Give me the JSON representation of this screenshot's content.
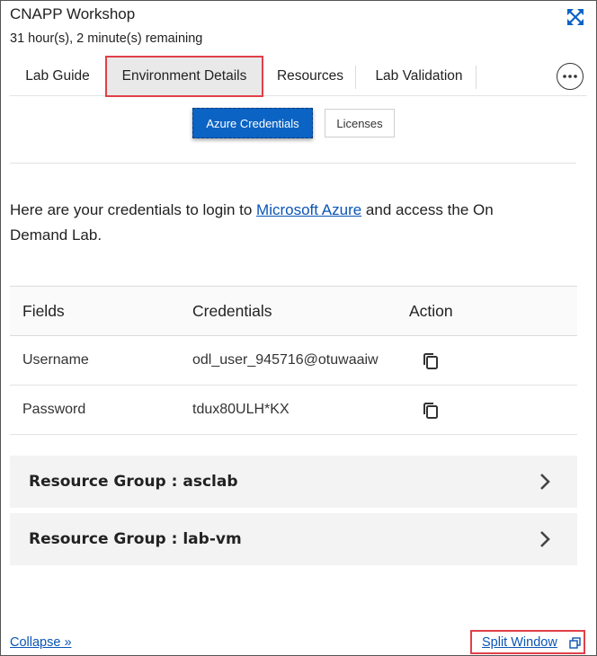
{
  "header": {
    "title": "CNAPP Workshop",
    "timer": "31 hour(s), 2 minute(s) remaining",
    "expand_icon": "expand-arrows-icon"
  },
  "tabs": [
    {
      "label": "Lab Guide",
      "active": false
    },
    {
      "label": "Environment Details",
      "active": true
    },
    {
      "label": "Resources",
      "active": false
    },
    {
      "label": "Lab Validation",
      "active": false
    }
  ],
  "more_icon": "ellipsis-icon",
  "subtabs": {
    "primary": "Azure Credentials",
    "secondary": "Licenses"
  },
  "intro": {
    "before": "Here are your credentials to login to ",
    "link": "Microsoft Azure",
    "after": " and access the On Demand Lab."
  },
  "credentials": {
    "headers": [
      "Fields",
      "Credentials",
      "Action"
    ],
    "rows": [
      {
        "field": "Username",
        "value": "odl_user_945716@otuwaaiw"
      },
      {
        "field": "Password",
        "value": "tdux80ULH*KX"
      }
    ],
    "copy_icon": "copy-icon"
  },
  "resource_groups": [
    {
      "label": "Resource Group : asclab"
    },
    {
      "label": "Resource Group : lab-vm"
    }
  ],
  "footer": {
    "collapse": "Collapse »",
    "split": "Split Window"
  },
  "colors": {
    "accent": "#0b63c4",
    "highlight": "#e0404a",
    "link": "#0b55b5"
  }
}
